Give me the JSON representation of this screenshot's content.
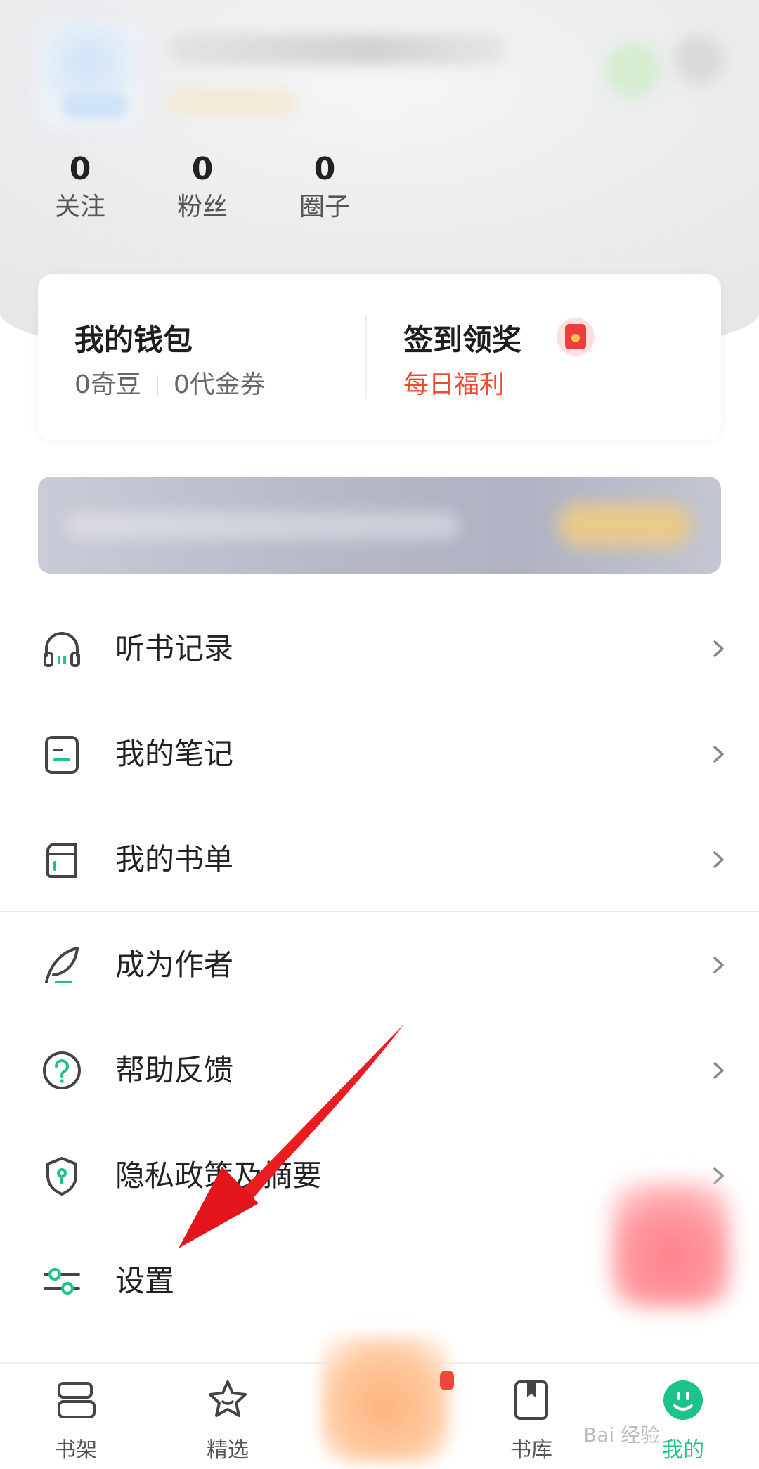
{
  "stats": [
    {
      "value": "0",
      "label": "关注"
    },
    {
      "value": "0",
      "label": "粉丝"
    },
    {
      "value": "0",
      "label": "圈子"
    }
  ],
  "wallet": {
    "title": "我的钱包",
    "beans": "0奇豆",
    "coupons": "0代金券"
  },
  "signin": {
    "title": "签到领奖",
    "subtitle": "每日福利"
  },
  "menu": [
    {
      "label": "听书记录",
      "icon": "headphones-icon"
    },
    {
      "label": "我的笔记",
      "icon": "note-icon"
    },
    {
      "label": "我的书单",
      "icon": "booklist-icon"
    },
    {
      "label": "成为作者",
      "icon": "feather-pen-icon"
    },
    {
      "label": "帮助反馈",
      "icon": "help-circle-icon"
    },
    {
      "label": "隐私政策及摘要",
      "icon": "shield-icon"
    },
    {
      "label": "设置",
      "icon": "settings-sliders-icon"
    }
  ],
  "tabs": [
    {
      "label": "书架",
      "icon": "bookshelf-icon"
    },
    {
      "label": "精选",
      "icon": "star-icon"
    },
    {
      "label": "书库",
      "icon": "book-icon"
    },
    {
      "label": "我的",
      "icon": "profile-smile-icon"
    }
  ],
  "colors": {
    "accent": "#1ec28b",
    "red": "#f04a2e",
    "arrow": "#e8141b"
  },
  "watermark": "Bai 经验"
}
